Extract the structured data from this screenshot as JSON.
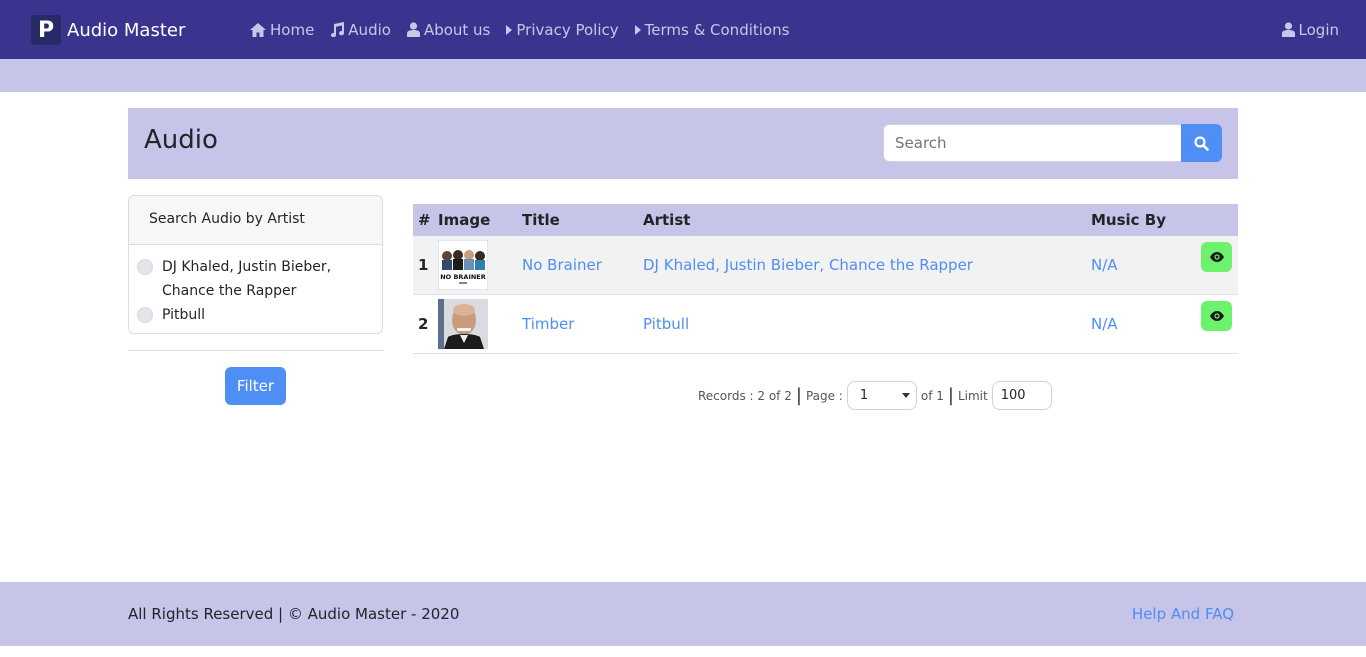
{
  "navbar": {
    "brand_logo": "P",
    "brand_name": "Audio Master",
    "links": [
      {
        "label": "Home",
        "icon": "home-icon"
      },
      {
        "label": "Audio",
        "icon": "music-icon"
      },
      {
        "label": "About us",
        "icon": "user-icon"
      },
      {
        "label": "Privacy Policy",
        "icon": "caret-right-icon"
      },
      {
        "label": "Terms & Conditions",
        "icon": "caret-right-icon"
      }
    ],
    "login_label": "Login"
  },
  "header": {
    "title": "Audio",
    "search_placeholder": "Search",
    "search_value": ""
  },
  "filter": {
    "heading": "Search Audio by Artist",
    "options": [
      "DJ Khaled, Justin Bieber, Chance the Rapper",
      "Pitbull"
    ],
    "button_label": "Filter"
  },
  "table": {
    "columns": [
      "#",
      "Image",
      "Title",
      "Artist",
      "Music By"
    ],
    "rows": [
      {
        "num": "1",
        "title": "No Brainer",
        "artist": "DJ Khaled, Justin Bieber, Chance the Rapper",
        "music_by": "N/A",
        "thumb_text": "NO BRAINER"
      },
      {
        "num": "2",
        "title": "Timber",
        "artist": "Pitbull",
        "music_by": "N/A",
        "thumb_text": ""
      }
    ]
  },
  "pager": {
    "records_label": "Records : 2 of 2",
    "page_label": "Page :",
    "page_value": "1",
    "of_label": "of 1",
    "limit_label": "Limit",
    "limit_value": "100"
  },
  "footer": {
    "copyright": "All Rights Reserved | © Audio Master - 2020",
    "help_link": "Help And FAQ"
  },
  "colors": {
    "navbar_bg": "#3b348f",
    "accent_light": "#c6c4e8",
    "primary_blue": "#4f8ef4",
    "view_green": "#6cf26c"
  }
}
